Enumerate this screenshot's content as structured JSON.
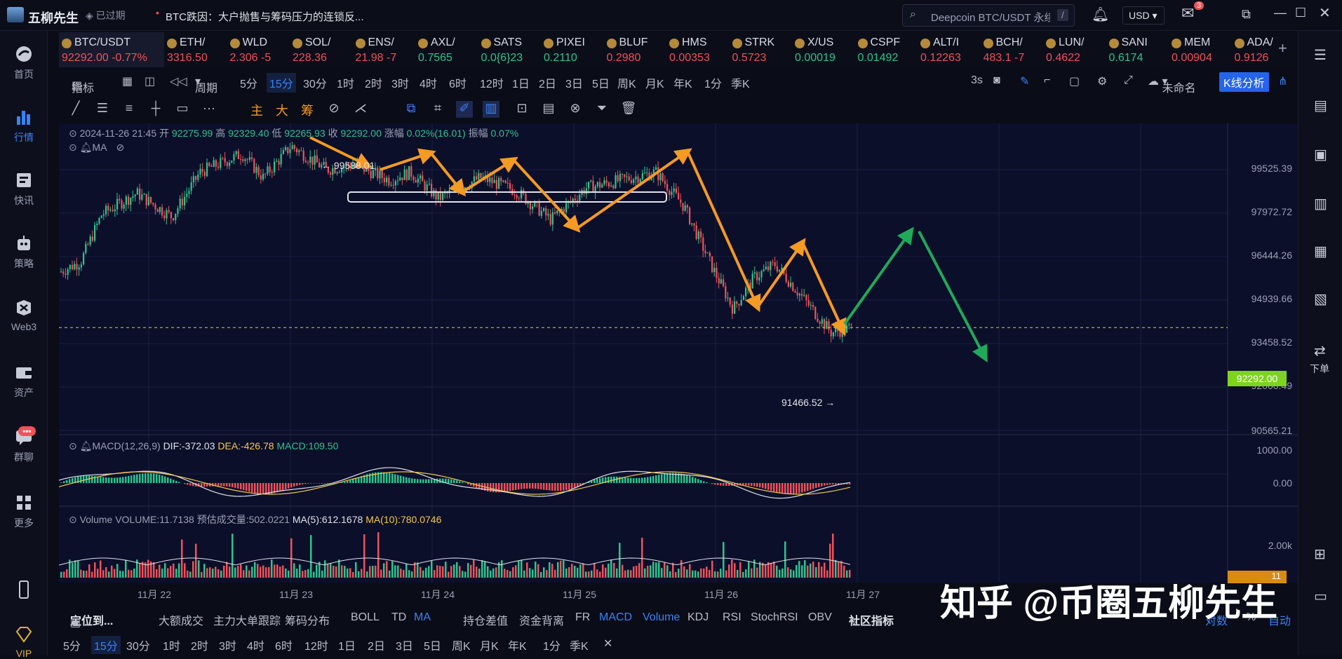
{
  "app": {
    "name": "五柳先生",
    "expired": "已过期",
    "news": "BTC跌因：大户抛售与筹码压力的连锁反...",
    "search_placeholder": "Deepcoin BTC/USDT 永续",
    "search_key": "/",
    "currency": "USD",
    "mail_badge": "3"
  },
  "nav": {
    "items": [
      "首页",
      "行情",
      "快讯",
      "策略",
      "Web3",
      "资产",
      "群聊",
      "更多"
    ],
    "chat_badge": "•••",
    "vip": "VIP",
    "right_download": "下单"
  },
  "tickers": [
    {
      "sym": "BTC/USDT",
      "price": "92292.00",
      "chg": "-0.77%",
      "dir": "red"
    },
    {
      "sym": "ETH/",
      "price": "3316.50",
      "chg": "",
      "dir": "red"
    },
    {
      "sym": "WLD",
      "price": "2.306",
      "chg": "-5",
      "dir": "red"
    },
    {
      "sym": "SOL/",
      "price": "228.36",
      "chg": "",
      "dir": "red"
    },
    {
      "sym": "ENS/",
      "price": "21.98",
      "chg": "-7",
      "dir": "red"
    },
    {
      "sym": "AXL/",
      "price": "0.7565",
      "chg": "",
      "dir": "green"
    },
    {
      "sym": "SATS",
      "price": "0.0{6}23",
      "chg": "",
      "dir": "green"
    },
    {
      "sym": "PIXEI",
      "price": "0.2110",
      "chg": "",
      "dir": "green"
    },
    {
      "sym": "BLUF",
      "price": "0.2980",
      "chg": "",
      "dir": "red"
    },
    {
      "sym": "HMS",
      "price": "0.00353",
      "chg": "",
      "dir": "red"
    },
    {
      "sym": "STRK",
      "price": "0.5723",
      "chg": "",
      "dir": "red"
    },
    {
      "sym": "X/US",
      "price": "0.00019",
      "chg": "",
      "dir": "green"
    },
    {
      "sym": "CSPF",
      "price": "0.01492",
      "chg": "",
      "dir": "green"
    },
    {
      "sym": "ALT/I",
      "price": "0.12263",
      "chg": "",
      "dir": "red"
    },
    {
      "sym": "BCH/",
      "price": "483.1",
      "chg": "-7",
      "dir": "red"
    },
    {
      "sym": "LUN/",
      "price": "0.4622",
      "chg": "",
      "dir": "red"
    },
    {
      "sym": "SANI",
      "price": "0.6174",
      "chg": "",
      "dir": "green"
    },
    {
      "sym": "MEM",
      "price": "0.00904",
      "chg": "",
      "dir": "red"
    },
    {
      "sym": "ADA/",
      "price": "0.9126",
      "chg": "",
      "dir": "red"
    }
  ],
  "toolbar": {
    "indicator": "指标",
    "period": "周期",
    "intervals": [
      "5分",
      "15分",
      "30分",
      "1时",
      "2时",
      "3时",
      "4时",
      "6时",
      "12时",
      "1日",
      "2日",
      "3日",
      "5日",
      "周K",
      "月K",
      "年K",
      "1分",
      "季K"
    ],
    "selected": "15分",
    "refresh": "3s",
    "layout_name": "未命名",
    "kline_button": "K线分析",
    "drawing_labels": [
      "主",
      "大",
      "筹"
    ]
  },
  "chart_info": {
    "date": "2024-11-26 21:45",
    "open_label": "开",
    "open": "92275.99",
    "high_label": "高",
    "high": "92329.40",
    "low_label": "低",
    "low": "92265.93",
    "close_label": "收",
    "close": "92292.00",
    "chg_label": "涨幅",
    "chg": "0.02%(16.01)",
    "amp_label": "振幅",
    "amp": "0.07%",
    "ma_label": "MA"
  },
  "annotations": {
    "high_marker": "99588.01",
    "low_marker": "91466.52"
  },
  "price_axis": [
    "99525.39",
    "97972.72",
    "96444.26",
    "94939.66",
    "93458.52",
    "92000.49",
    "90565.21"
  ],
  "current_price": "92292.00",
  "macd": {
    "label": "MACD(12,26,9)",
    "dif": "DIF:-372.03",
    "dea": "DEA:-426.78",
    "macd": "MACD:109.50",
    "axis": [
      "1000.00",
      "0.00"
    ]
  },
  "volume": {
    "label": "Volume",
    "vol": "VOLUME:11.7138",
    "est": "预估成交量:502.0221",
    "ma5": "MA(5):612.1678",
    "ma10": "MA(10):780.0746",
    "axis": [
      "2.00k",
      "11"
    ]
  },
  "time_axis": [
    "11月 22",
    "11月 23",
    "11月 24",
    "11月 25",
    "11月 26",
    "11月 27"
  ],
  "indicators_bar": {
    "locate": "定位到...",
    "items": [
      "大额成交",
      "主力大单跟踪",
      "筹码分布",
      "BOLL",
      "TD",
      "MA",
      "持仓差值",
      "资金背离",
      "FR",
      "MACD",
      "Volume",
      "KDJ",
      "RSI",
      "StochRSI",
      "OBV"
    ],
    "active": [
      "MA",
      "MACD",
      "Volume"
    ],
    "community": "社区指标",
    "log": "对数",
    "pct": "%",
    "auto": "自动"
  },
  "watermark": "知乎 @币圈五柳先生",
  "colors": {
    "up": "#2fc48d",
    "down": "#f0525a",
    "accent": "#3b82f6",
    "arrow_orange": "#f59a23",
    "arrow_green": "#1faa59",
    "price_tag": "#7ed321"
  }
}
